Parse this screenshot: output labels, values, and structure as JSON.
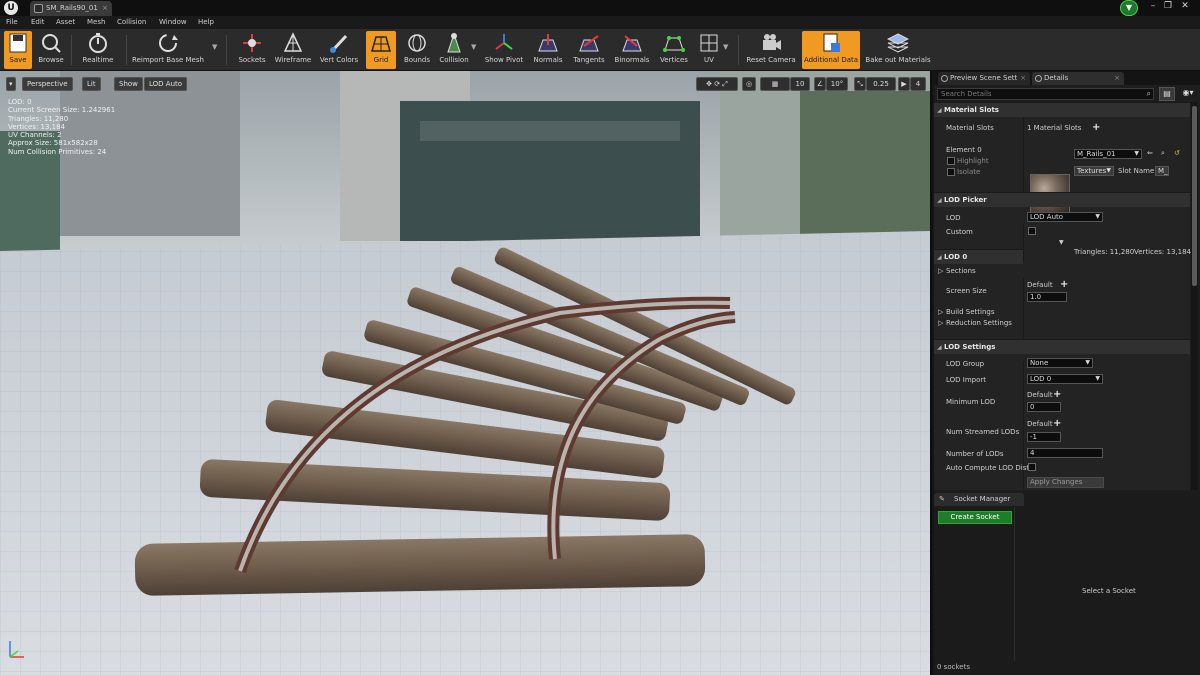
{
  "window": {
    "tab_title": "SM_Rails90_01",
    "logo": "U"
  },
  "menu": [
    "File",
    "Edit",
    "Asset",
    "Mesh",
    "Collision",
    "Window",
    "Help"
  ],
  "toolbar": {
    "save": "Save",
    "browse": "Browse",
    "realtime": "Realtime",
    "reimport": "Reimport Base Mesh",
    "sockets": "Sockets",
    "wireframe": "Wireframe",
    "vert_colors": "Vert Colors",
    "grid": "Grid",
    "bounds": "Bounds",
    "collision": "Collision",
    "show_pivot": "Show Pivot",
    "normals": "Normals",
    "tangents": "Tangents",
    "binormals": "Binormals",
    "vertices": "Vertices",
    "uv": "UV",
    "reset_camera": "Reset Camera",
    "additional_data": "Additional Data",
    "bake_out": "Bake out Materials"
  },
  "viewport": {
    "perspective": "Perspective",
    "lit": "Lit",
    "show": "Show",
    "lod_auto": "LOD Auto",
    "stats": [
      "LOD: 0",
      "Current Screen Size: 1.242961",
      "Triangles: 11,280",
      "Vertices: 13,184",
      "UV Channels: 2",
      "Approx Size: 581x582x28",
      "Num Collision Primitives: 24"
    ],
    "snap_grid": "10",
    "snap_rot": "10°",
    "snap_scale": "0.25",
    "cam_speed": "4"
  },
  "panel": {
    "tab_scene": "Preview Scene Sett",
    "tab_details": "Details",
    "search_placeholder": "Search Details",
    "material_slots": {
      "header": "Material Slots",
      "label": "Material Slots",
      "count": "1 Material Slots",
      "element": "Element 0",
      "highlight": "Highlight",
      "isolate": "Isolate",
      "material": "M_Rails_01",
      "textures": "Textures",
      "slot_name_label": "Slot Name",
      "slot_name": "M_"
    },
    "lod_picker": {
      "header": "LOD Picker",
      "lod_label": "LOD",
      "lod_value": "LOD Auto",
      "custom": "Custom",
      "triangles": "Triangles: 11,280",
      "vertices": "Vertices: 13,184"
    },
    "lod0": {
      "header": "LOD 0",
      "sections": "Sections",
      "screen_size": "Screen Size",
      "default": "Default",
      "screen_size_value": "1.0",
      "build": "Build Settings",
      "reduction": "Reduction Settings"
    },
    "lod_settings": {
      "header": "LOD Settings",
      "lod_group": "LOD Group",
      "lod_group_value": "None",
      "lod_import": "LOD Import",
      "lod_import_value": "LOD 0",
      "min_lod": "Minimum LOD",
      "default": "Default",
      "min_lod_value": "0",
      "num_streamed": "Num Streamed LODs",
      "num_streamed_value": "-1",
      "num_lods": "Number of LODs",
      "num_lods_value": "4",
      "auto_compute": "Auto Compute LOD Dista",
      "apply": "Apply Changes"
    },
    "sockets": {
      "tab": "Socket Manager",
      "create": "Create Socket",
      "empty": "Select a Socket",
      "count": "0 sockets"
    }
  },
  "colors": {
    "accent": "#f09a22",
    "create_button": "#1d7d29"
  }
}
